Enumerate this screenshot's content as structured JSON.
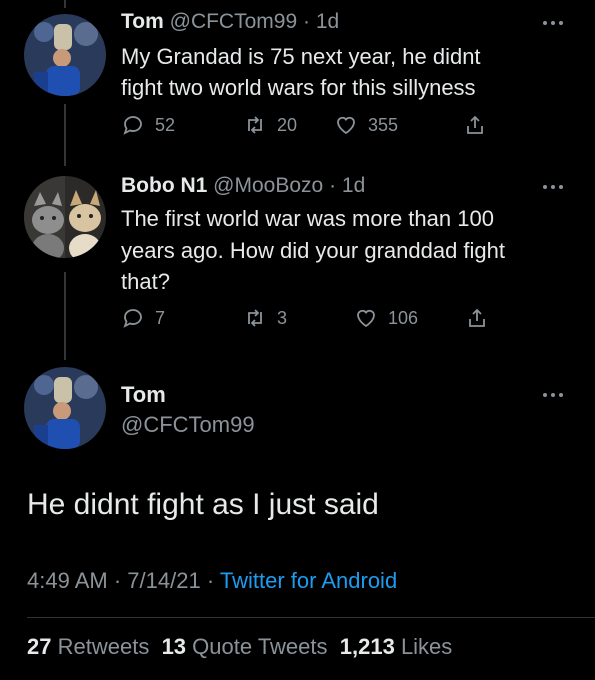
{
  "tweet1": {
    "name": "Tom",
    "handle": "@CFCTom99",
    "separator": "·",
    "time": "1d",
    "text_lines": [
      "My Grandad is 75 next year,  he didnt",
      "fight two world wars for this sillyness"
    ],
    "replies": "52",
    "retweets": "20",
    "likes": "355"
  },
  "tweet2": {
    "name": "Bobo N1",
    "handle": "@MooBozo",
    "separator": "·",
    "time": "1d",
    "text_lines": [
      "The first world war was more than 100",
      "years ago. How did your granddad fight",
      "that?"
    ],
    "replies": "7",
    "retweets": "3",
    "likes": "106"
  },
  "main_tweet": {
    "name": "Tom",
    "handle": "@CFCTom99",
    "text": "He didnt fight as I just said",
    "time": "4:49 AM",
    "date": "7/14/21",
    "separator": "·",
    "source": "Twitter for Android",
    "stats": {
      "retweets_count": "27",
      "retweets_label": "Retweets",
      "quotes_count": "13",
      "quotes_label": "Quote Tweets",
      "likes_count": "1,213",
      "likes_label": "Likes"
    }
  },
  "colors": {
    "background": "#000000",
    "text": "#e7e9ea",
    "secondary": "#8b9399",
    "link": "#1d9bf0"
  },
  "icons": [
    "reply-icon",
    "retweet-icon",
    "like-icon",
    "share-icon",
    "more-icon"
  ]
}
